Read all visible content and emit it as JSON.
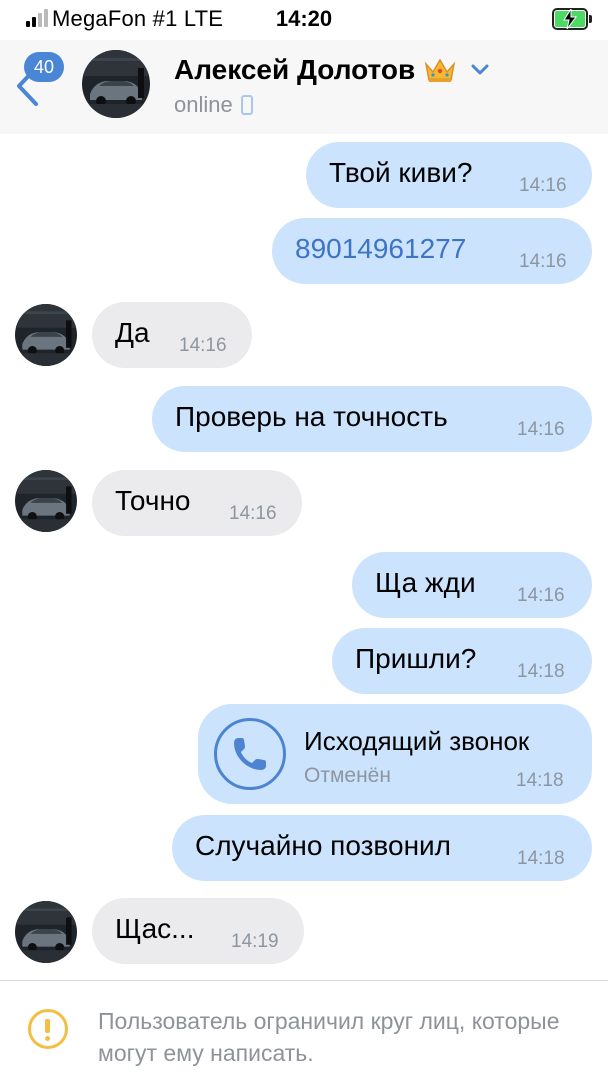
{
  "status_bar": {
    "carrier": "MegaFon #1  LTE",
    "time": "14:20"
  },
  "header": {
    "unread_badge": "40",
    "contact_name": "Алексей Долотов",
    "status": "online",
    "badge_icon": "crown-emoji",
    "accent_color": "#4a86d6"
  },
  "messages": [
    {
      "direction": "out",
      "text": "Твой киви?",
      "time": "14:16"
    },
    {
      "direction": "out",
      "text": "89014961277",
      "time": "14:16",
      "is_link": true
    },
    {
      "direction": "in",
      "text": "Да",
      "time": "14:16"
    },
    {
      "direction": "out",
      "text": "Проверь на точность",
      "time": "14:16"
    },
    {
      "direction": "in",
      "text": "Точно",
      "time": "14:16"
    },
    {
      "direction": "out",
      "text": "Ща жди",
      "time": "14:16"
    },
    {
      "direction": "out",
      "text": "Пришли?",
      "time": "14:18"
    },
    {
      "direction": "out",
      "type": "call",
      "title": "Исходящий звонок",
      "subtitle": "Отменён",
      "time": "14:18"
    },
    {
      "direction": "out",
      "text": "Случайно позвонил",
      "time": "14:18"
    },
    {
      "direction": "in",
      "text": "Щас...",
      "time": "14:19"
    }
  ],
  "footer": {
    "notice": "Пользователь ограничил круг лиц, которые могут ему написать."
  },
  "colors": {
    "outgoing_bubble": "#cce3fd",
    "incoming_bubble": "#ebebed",
    "link": "#3e74c6",
    "warning": "#f3be43"
  }
}
